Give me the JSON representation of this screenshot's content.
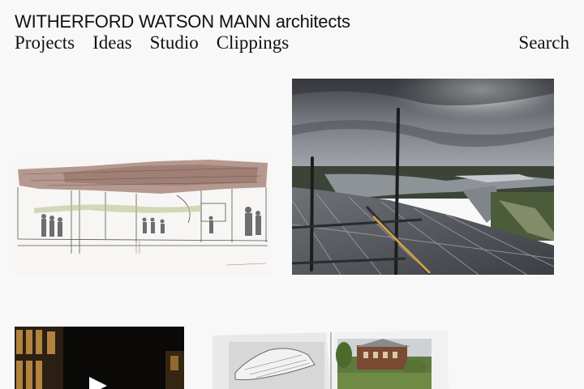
{
  "header": {
    "brand": "WITHERFORD WATSON MANN architects",
    "nav": [
      "Projects",
      "Ideas",
      "Studio",
      "Clippings"
    ],
    "search_label": "Search"
  }
}
